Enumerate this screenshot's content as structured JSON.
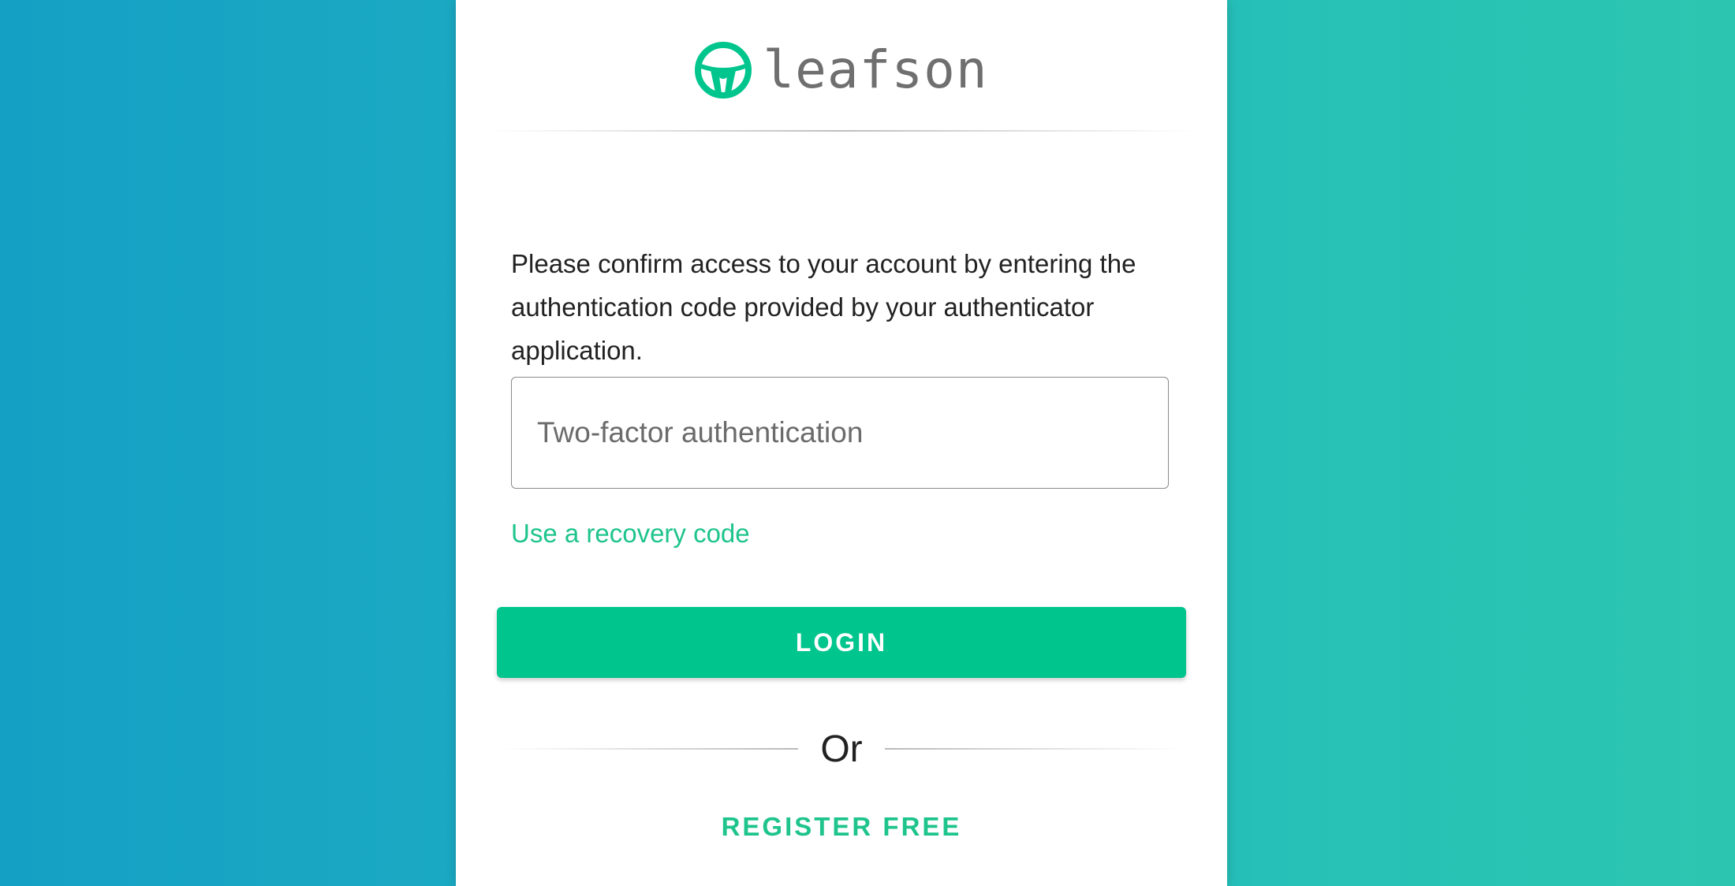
{
  "brand": {
    "name": "leafson",
    "logo_icon": "steering-wheel-logo",
    "accent_color": "#00c58d"
  },
  "two_factor": {
    "message": "Please confirm access to your account by entering the authentication code provided by your authenticator application.",
    "code_input": {
      "placeholder": "Two-factor authentication",
      "value": ""
    },
    "recovery_link_label": "Use a recovery code",
    "login_button_label": "LOGIN",
    "divider_label": "Or",
    "register_label": "REGISTER FREE"
  }
}
